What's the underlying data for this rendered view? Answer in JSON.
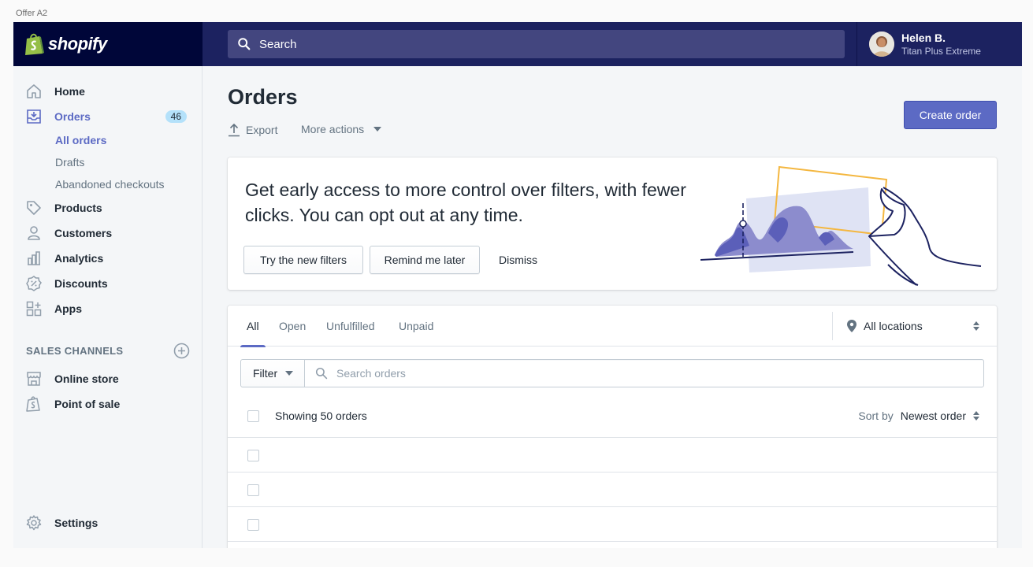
{
  "frame_label": "Offer A2",
  "brand": {
    "name": "shopify"
  },
  "search": {
    "placeholder": "Search"
  },
  "user": {
    "name": "Helen B.",
    "shop": "Titan Plus Extreme"
  },
  "sidebar": {
    "items": [
      {
        "label": "Home",
        "icon": "home-icon"
      },
      {
        "label": "Orders",
        "icon": "orders-icon",
        "badge": "46"
      },
      {
        "label": "Products",
        "icon": "tag-icon"
      },
      {
        "label": "Customers",
        "icon": "customer-icon"
      },
      {
        "label": "Analytics",
        "icon": "analytics-icon"
      },
      {
        "label": "Discounts",
        "icon": "discount-icon"
      },
      {
        "label": "Apps",
        "icon": "apps-icon"
      }
    ],
    "orders_sub": [
      "All orders",
      "Drafts",
      "Abandoned checkouts"
    ],
    "sales_channels_heading": "SALES CHANNELS",
    "channels": [
      {
        "label": "Online store",
        "icon": "store-icon"
      },
      {
        "label": "Point of sale",
        "icon": "pos-icon"
      }
    ],
    "settings": "Settings"
  },
  "page": {
    "title": "Orders",
    "export": "Export",
    "more_actions": "More actions",
    "create_order": "Create order"
  },
  "banner": {
    "text": "Get early access to more control over filters, with fewer clicks. You can opt out at any time.",
    "try_button": "Try the new filters",
    "remind_button": "Remind me later",
    "dismiss": "Dismiss"
  },
  "orders_card": {
    "tabs": [
      "All",
      "Open",
      "Unfulfilled",
      "Unpaid"
    ],
    "active_tab": "All",
    "location": "All locations",
    "filter": "Filter",
    "search_placeholder": "Search orders",
    "showing": "Showing 50 orders",
    "sort_label": "Sort by",
    "sort_value": "Newest order"
  },
  "colors": {
    "accent": "#5c6ac4",
    "topbar": "#1c2260",
    "logo_bg": "#000639"
  }
}
